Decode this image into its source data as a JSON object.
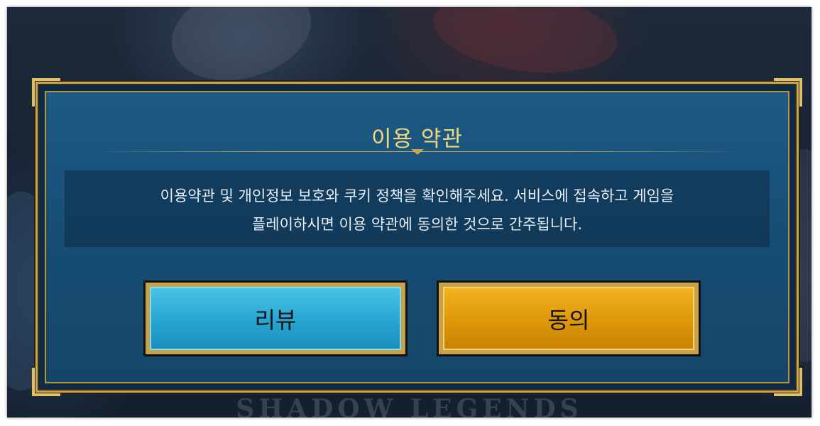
{
  "dialog": {
    "title": "이용 약관",
    "message_line1": "이용약관 및 개인정보 보호와 쿠키 정책을 확인해주세요. 서비스에 접속하고 게임을",
    "message_line2": "플레이하시면 이용 약관에 동의한 것으로 간주됩니다.",
    "review_button": "리뷰",
    "agree_button": "동의"
  },
  "background": {
    "watermark": "SHADOW LEGENDS"
  },
  "colors": {
    "title": "#f1d77a",
    "frame_gold": "#c9a650",
    "panel_blue": "#1c5a85",
    "review_button": "#27a5d2",
    "agree_button": "#dd9708"
  }
}
